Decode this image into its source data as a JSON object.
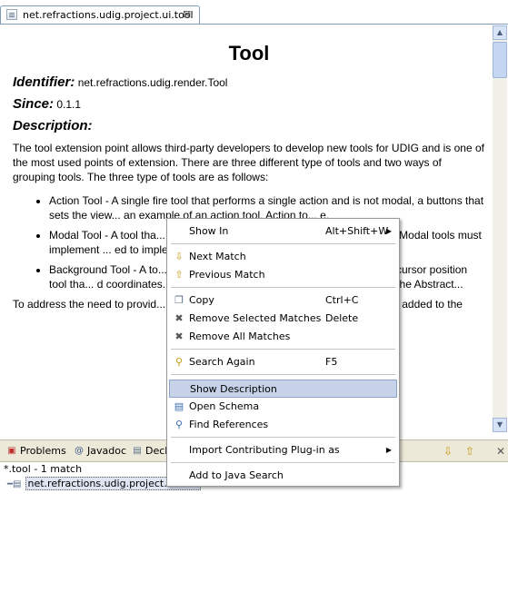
{
  "editor": {
    "tab_title": "net.refractions.udig.project.ui.tool",
    "tab_close": "⊠"
  },
  "doc": {
    "title": "Tool",
    "identifier_label": "Identifier:",
    "identifier_value": "net.refractions.udig.render.Tool",
    "since_label": "Since:",
    "since_value": "0.1.1",
    "description_label": "Description:",
    "description_intro": "The tool extension point allows third-party developers to develop new tools for UDIG and is one of the most used points of extension. There are three different type of tools and two ways of grouping tools. The three type of tools are as follows:",
    "tool_types": [
      "Action Tool - A single fire tool that performs a single action and is not modal, a buttons that sets the view... an example of an action tool. Action to... e.",
      "Modal Tool - A tool tha... s \"on\" it waits for user input and reac... om tool. Modal tools must implement ... ed to implement the AbstractModalTool",
      "Background Tool - A to... A typical background tool would... ample is the cursor position tool tha... d coordinates. Background tools mus... mended to implement the Abstract..."
    ],
    "description_outro": "To address the need to provid... pers can add tools to views. In addition, a s... re added to the"
  },
  "views": {
    "tabs": [
      {
        "label": "Problems",
        "icon": "problems-icon"
      },
      {
        "label": "Javadoc",
        "icon": "at-icon"
      },
      {
        "label": "Decl",
        "icon": "declaration-icon"
      }
    ],
    "toolbar": {
      "next_icon": "arrow-down-icon",
      "prev_icon": "arrow-up-icon",
      "close_icon": "close-icon"
    }
  },
  "search": {
    "result_header": "*.tool - 1 match",
    "result_item": "net.refractions.udig.project.ui.tool"
  },
  "context_menu": {
    "items": [
      {
        "label": "Show In",
        "shortcut": "Alt+Shift+W",
        "submenu": true
      },
      {
        "label": "Next Match",
        "icon": "next-match-icon"
      },
      {
        "label": "Previous Match",
        "icon": "previous-match-icon"
      },
      {
        "label": "Copy",
        "shortcut": "Ctrl+C",
        "icon": "copy-icon"
      },
      {
        "label": "Remove Selected Matches",
        "shortcut": "Delete",
        "icon": "remove-icon"
      },
      {
        "label": "Remove All Matches",
        "icon": "remove-all-icon"
      },
      {
        "label": "Search Again",
        "shortcut": "F5",
        "icon": "search-icon"
      },
      {
        "label": "Show Description",
        "icon": "description-icon",
        "selected": true
      },
      {
        "label": "Open Schema",
        "icon": "schema-icon"
      },
      {
        "label": "Find References",
        "icon": "references-icon"
      },
      {
        "label": "Import Contributing Plug-in as",
        "submenu": true
      },
      {
        "label": "Add to Java Search"
      }
    ]
  },
  "colors": {
    "selection": "#c5d2e8",
    "tab_border": "#7f9db9",
    "view_bar": "#ece9d8"
  }
}
